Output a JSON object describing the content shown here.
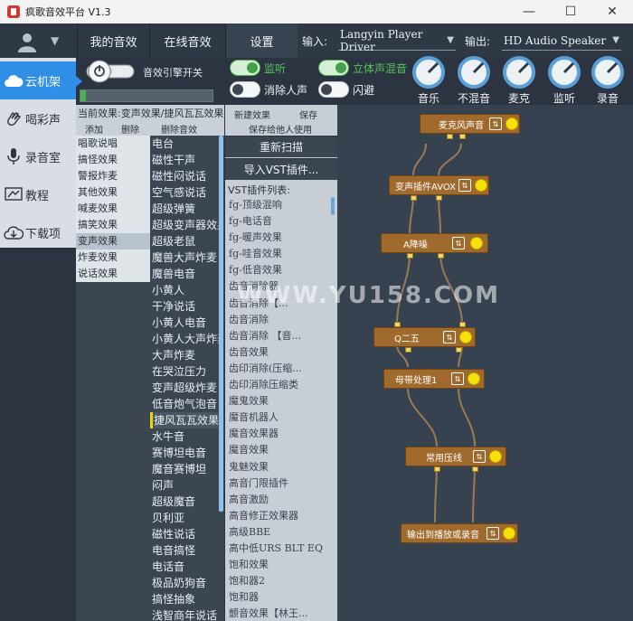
{
  "window": {
    "title": "疯歌音效平台 V1.3",
    "controls": [
      "—",
      "☐",
      "✕"
    ]
  },
  "nav": {
    "tabs": [
      "我的音效",
      "在线音效",
      "设置"
    ],
    "input_label": "输入:",
    "input_value": "Langyin Player Driver",
    "output_label": "输出:",
    "output_value": "HD Audio Speaker"
  },
  "sidebar": {
    "items": [
      {
        "label": "云机架",
        "icon": "cloud-icon"
      },
      {
        "label": "喝彩声",
        "icon": "clap-icon"
      },
      {
        "label": "录音室",
        "icon": "microphone-icon"
      },
      {
        "label": "教程",
        "icon": "tutorial-icon"
      },
      {
        "label": "下载项",
        "icon": "download-icon"
      }
    ]
  },
  "engine": {
    "label": "音效引擎开关",
    "meter_level": 0.04
  },
  "toggles": [
    {
      "label": "监听",
      "on": true
    },
    {
      "label": "立体声混音",
      "on": true
    },
    {
      "label": "消除人声",
      "on": false
    },
    {
      "label": "闪避",
      "on": false
    }
  ],
  "knobs": [
    "音乐",
    "不混音",
    "麦克",
    "监听",
    "录音"
  ],
  "effects_panel": {
    "current": "当前效果:变声效果/捷风瓦瓦效果",
    "actions": [
      "添加",
      "删除",
      "删除音效"
    ],
    "categories": [
      "唱歌说唱",
      "搞怪效果",
      "警报炸麦",
      "其他效果",
      "喊麦效果",
      "搞笑效果",
      "变声效果",
      "炸麦效果",
      "说话效果"
    ],
    "selected_category": 6,
    "effects": [
      "电台",
      "磁性干声",
      "磁性闷说话",
      "空气感说话",
      "超级弹簧",
      "超级变声器效果",
      "超级老鼠",
      "魔兽大声炸麦",
      "魔兽电音",
      "小黄人",
      "干净说话",
      "小黄人电音",
      "小黄人大声炸麦",
      "大声炸麦",
      "在哭泣压力",
      "变声超级炸麦",
      "低音炮气泡音",
      "捷风瓦瓦效果",
      "水牛音",
      "赛博坦电音",
      "魔音赛博坦",
      "闷声",
      "超级魔音",
      "贝利亚",
      "磁性说话",
      "电音搞怪",
      "电话音",
      "极品奶狗音",
      "搞怪抽象",
      "浅智商年说话"
    ],
    "selected_effect": 17
  },
  "vst_panel": {
    "new_effect": "新建效果",
    "save": "保存",
    "share": "保存给他人使用",
    "rescan": "重新扫描",
    "import": "导入VST插件...",
    "list_title": "VST插件列表:",
    "plugins": [
      "fg-顶级混响",
      "fg-电话音",
      "fg-暖声效果",
      "fg-哇音效果",
      "fg-低音效果",
      "齿音消除器",
      "齿音消除【...",
      "齿音消除",
      "齿音消除    【音...",
      "齿音效果",
      "齿印消除(压缩...",
      "齿印消除压缩类",
      "魔鬼效果",
      "魔音机器人",
      "魔音效果器",
      "魔音效果",
      "鬼魅效果",
      "高音门限插件",
      "高音激励",
      "高音修正效果器",
      "高级BBE",
      "高中低URS BLT EQ",
      "饱和效果",
      "饱和器2",
      "饱和器",
      "颤音效果【林王..."
    ]
  },
  "chain": {
    "nodes": [
      "麦克风声音",
      "变声插件AVOX",
      "A降噪",
      "Q二五",
      "母带处理1",
      "常用压线",
      "输出到播放或录音"
    ]
  },
  "watermark": "WWW.YU158.COM",
  "colors": {
    "accent": "#2f8ee5",
    "node": "#a06a2c",
    "toggle_on": "#43a047",
    "dot": "#f7e10b"
  }
}
